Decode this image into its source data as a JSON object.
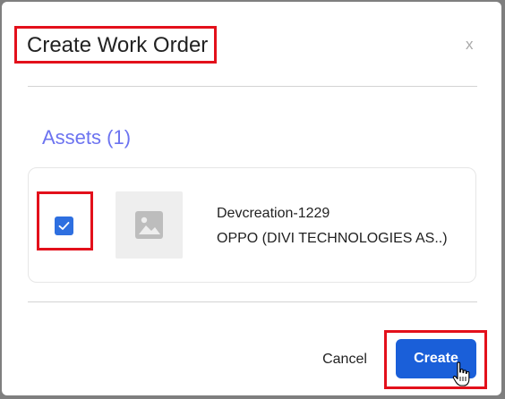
{
  "dialog": {
    "title": "Create Work Order",
    "close_label": "x"
  },
  "assets": {
    "heading": "Assets (1)",
    "items": [
      {
        "checked": true,
        "name": "Devcreation-1229",
        "subtitle": "OPPO (DIVI TECHNOLOGIES AS..)",
        "thumbnail_icon": "image-placeholder-icon"
      }
    ]
  },
  "footer": {
    "cancel_label": "Cancel",
    "create_label": "Create"
  },
  "colors": {
    "accent": "#1a5fd9",
    "heading": "#6c73f0",
    "highlight": "#e3101b"
  }
}
